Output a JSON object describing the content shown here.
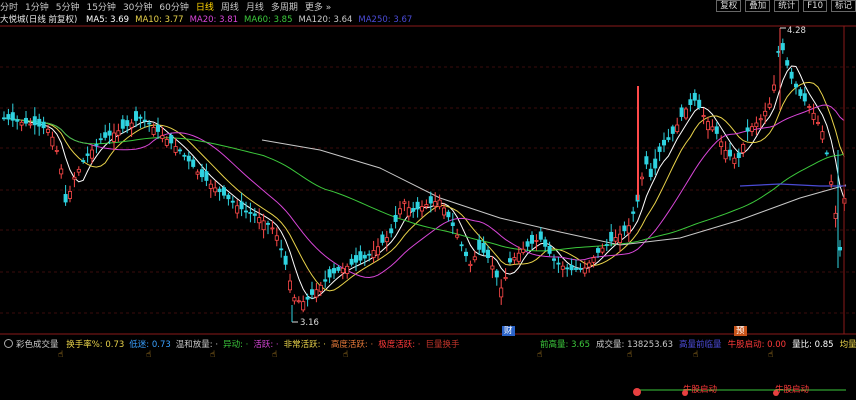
{
  "toolbar": {
    "timeframes": [
      "分时",
      "1分钟",
      "5分钟",
      "15分钟",
      "30分钟",
      "60分钟",
      "日线",
      "周线",
      "月线",
      "多周期",
      "更多"
    ],
    "active_index": 6,
    "right_buttons": [
      "复权",
      "叠加",
      "统计",
      "F10",
      "标记"
    ]
  },
  "legend": {
    "name": "大悦城(日线 前复权)",
    "ma": [
      {
        "label": "MA5: 3.69",
        "color": "#ffffff"
      },
      {
        "label": "MA10: 3.77",
        "color": "#e8d24a"
      },
      {
        "label": "MA20: 3.81",
        "color": "#d846d8"
      },
      {
        "label": "MA60: 3.85",
        "color": "#3cc83c"
      },
      {
        "label": "MA120: 3.64",
        "color": "#c8c8c8"
      },
      {
        "label": "MA250: 3.67",
        "color": "#4b4bd6"
      }
    ]
  },
  "chart_data": {
    "type": "candlestick",
    "high_label": "4.28",
    "low_label": "3.16",
    "event_tags": [
      "财",
      "预"
    ]
  },
  "sub": {
    "indicator": "彩色成交量",
    "items": [
      {
        "label": "换手率%: 0.73",
        "color": "#e8d24a"
      },
      {
        "label": "低迷: 0.73",
        "color": "#3aa0ff"
      },
      {
        "label": "温和放量: ·",
        "color": "#c8c8c8"
      },
      {
        "label": "异动: ·",
        "color": "#3cc83c"
      },
      {
        "label": "活跃: ·",
        "color": "#d846d8"
      },
      {
        "label": "非常活跃: ·",
        "color": "#e8d24a"
      },
      {
        "label": "高度活跃: ·",
        "color": "#e87a3a"
      },
      {
        "label": "极度活跃: ·",
        "color": "#ff3a3a"
      },
      {
        "label": "巨量换手",
        "color": "#c0342a"
      }
    ],
    "right_items": [
      {
        "label": "前高量: 3.65",
        "color": "#3cc83c"
      },
      {
        "label": "成交量: 138253.63",
        "color": "#c8c8c8"
      },
      {
        "label": "高量前临量",
        "color": "#4b4bd6"
      },
      {
        "label": "牛股启动: 0.00",
        "color": "#ff3a3a"
      },
      {
        "label": "量比: 0.85",
        "color": "#ffffff"
      },
      {
        "label": "均量金叉",
        "color": "#e8d24a"
      }
    ]
  },
  "bottom": {
    "signal_label": "牛股启动"
  }
}
